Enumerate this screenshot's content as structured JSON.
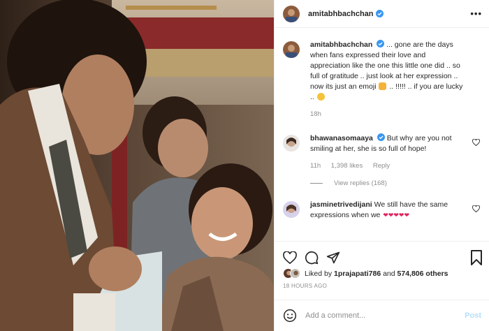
{
  "photo": {
    "icon": "photo-icon"
  },
  "header": {
    "username": "amitabhbachchan",
    "more_label": "•••"
  },
  "caption": {
    "username": "amitabhbachchan",
    "text_1": "... gone are the days when fans expressed their love and appreciation like the one this little one did .. so full of gratitude .. just look at her expression .. now its just an emoji",
    "text_2": ".. !!!!! .. if you are lucky ..",
    "time": "18h"
  },
  "comments": [
    {
      "username": "bhawanasomaaya",
      "text": "But why are you not smiling at her, she is so full of hope!",
      "time": "11h",
      "likes": "1,398 likes",
      "reply": "Reply",
      "view_replies": "View replies (168)"
    },
    {
      "username": "jasminetrivedijani",
      "text": "We still have the same expressions when we"
    }
  ],
  "likes": {
    "prefix": "Liked by",
    "user": "1prajapati786",
    "middle": "and",
    "count": "574,806 others"
  },
  "timestamp": "18 HOURS AGO",
  "add_comment": {
    "placeholder": "Add a comment...",
    "post_label": "Post"
  },
  "colors": {
    "link_disabled": "#b2dffc",
    "verified": "#3897f0",
    "text_secondary": "#8e8e8e"
  }
}
